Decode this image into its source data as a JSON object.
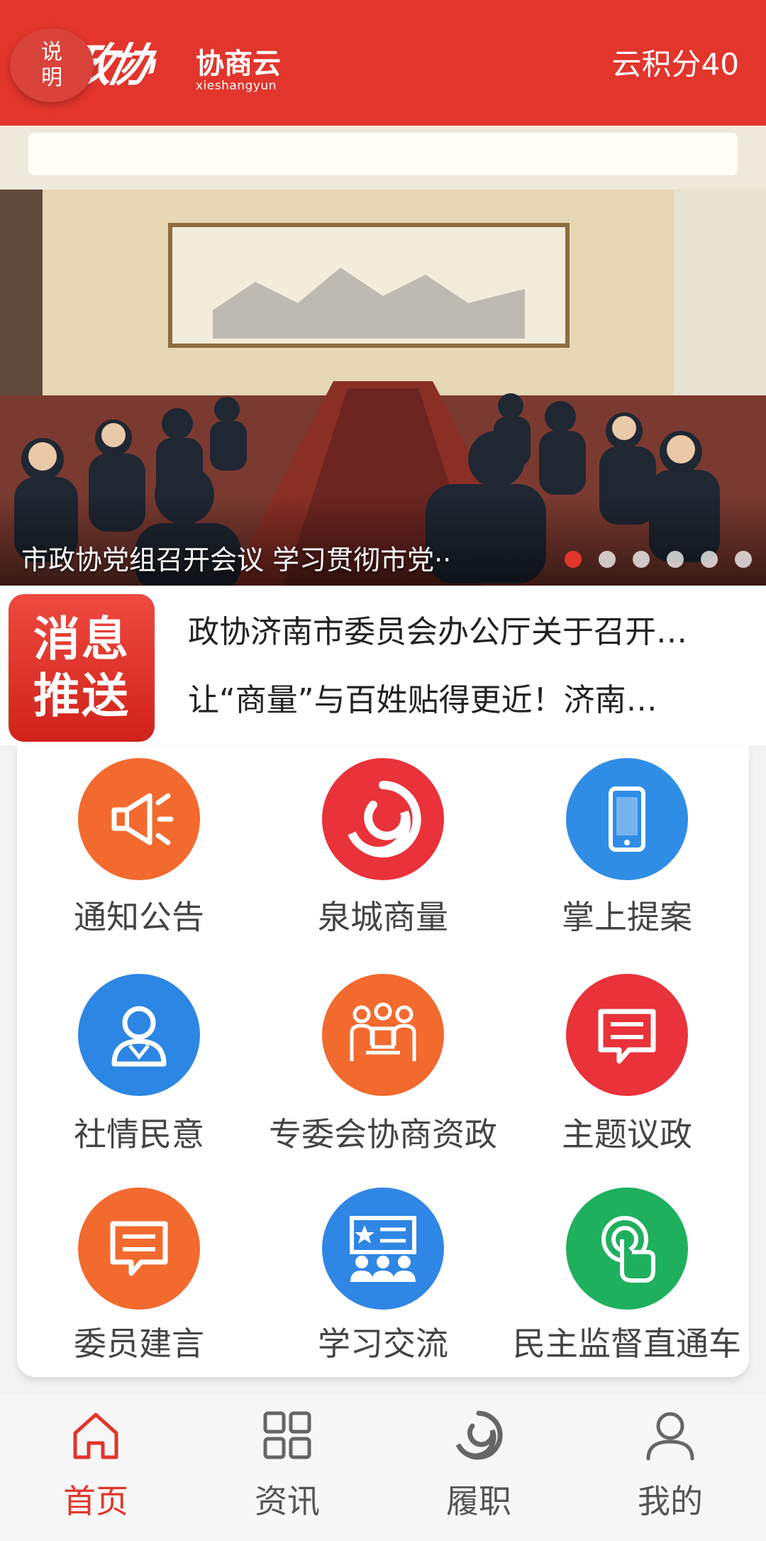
{
  "header": {
    "explain_badge_line1": "说",
    "explain_badge_line2": "明",
    "logo_brush": "政协",
    "logo_cn": "协商云",
    "logo_en": "xieshangyun",
    "points": "云积分40"
  },
  "banner": {
    "caption": "市政协党组召开会议 学习贯彻市党··",
    "slide_count": 6,
    "active_slide": 1
  },
  "ticker": {
    "badge_line1": "消息",
    "badge_line2": "推送",
    "items": [
      "政协济南市委员会办公厅关于召开…",
      "让“商量”与百姓贴得更近！济南…"
    ]
  },
  "grid": {
    "items": [
      {
        "label": "通知公告",
        "icon": "megaphone-icon",
        "color": "#f26a2e"
      },
      {
        "label": "泉城商量",
        "icon": "swirl-icon",
        "color": "#e9323a"
      },
      {
        "label": "掌上提案",
        "icon": "phone-icon",
        "color": "#2f8de6"
      },
      {
        "label": "社情民意",
        "icon": "person-icon",
        "color": "#2c86e4"
      },
      {
        "label": "专委会协商资政",
        "icon": "meeting-icon",
        "color": "#f26a2e"
      },
      {
        "label": "主题议政",
        "icon": "chat-icon",
        "color": "#e9323a"
      },
      {
        "label": "委员建言",
        "icon": "comment-icon",
        "color": "#f26a2e"
      },
      {
        "label": "学习交流",
        "icon": "study-icon",
        "color": "#2f86e4"
      },
      {
        "label": "民主监督直通车",
        "icon": "touch-icon",
        "color": "#1fb05e"
      }
    ]
  },
  "bottom_nav": {
    "items": [
      {
        "label": "首页",
        "icon": "home-icon",
        "active": true
      },
      {
        "label": "资讯",
        "icon": "grid-icon",
        "active": false
      },
      {
        "label": "履职",
        "icon": "swirl-icon",
        "active": false
      },
      {
        "label": "我的",
        "icon": "user-icon",
        "active": false
      }
    ]
  },
  "colors": {
    "brand_red": "#e2352c",
    "inactive_gray": "#555555"
  }
}
